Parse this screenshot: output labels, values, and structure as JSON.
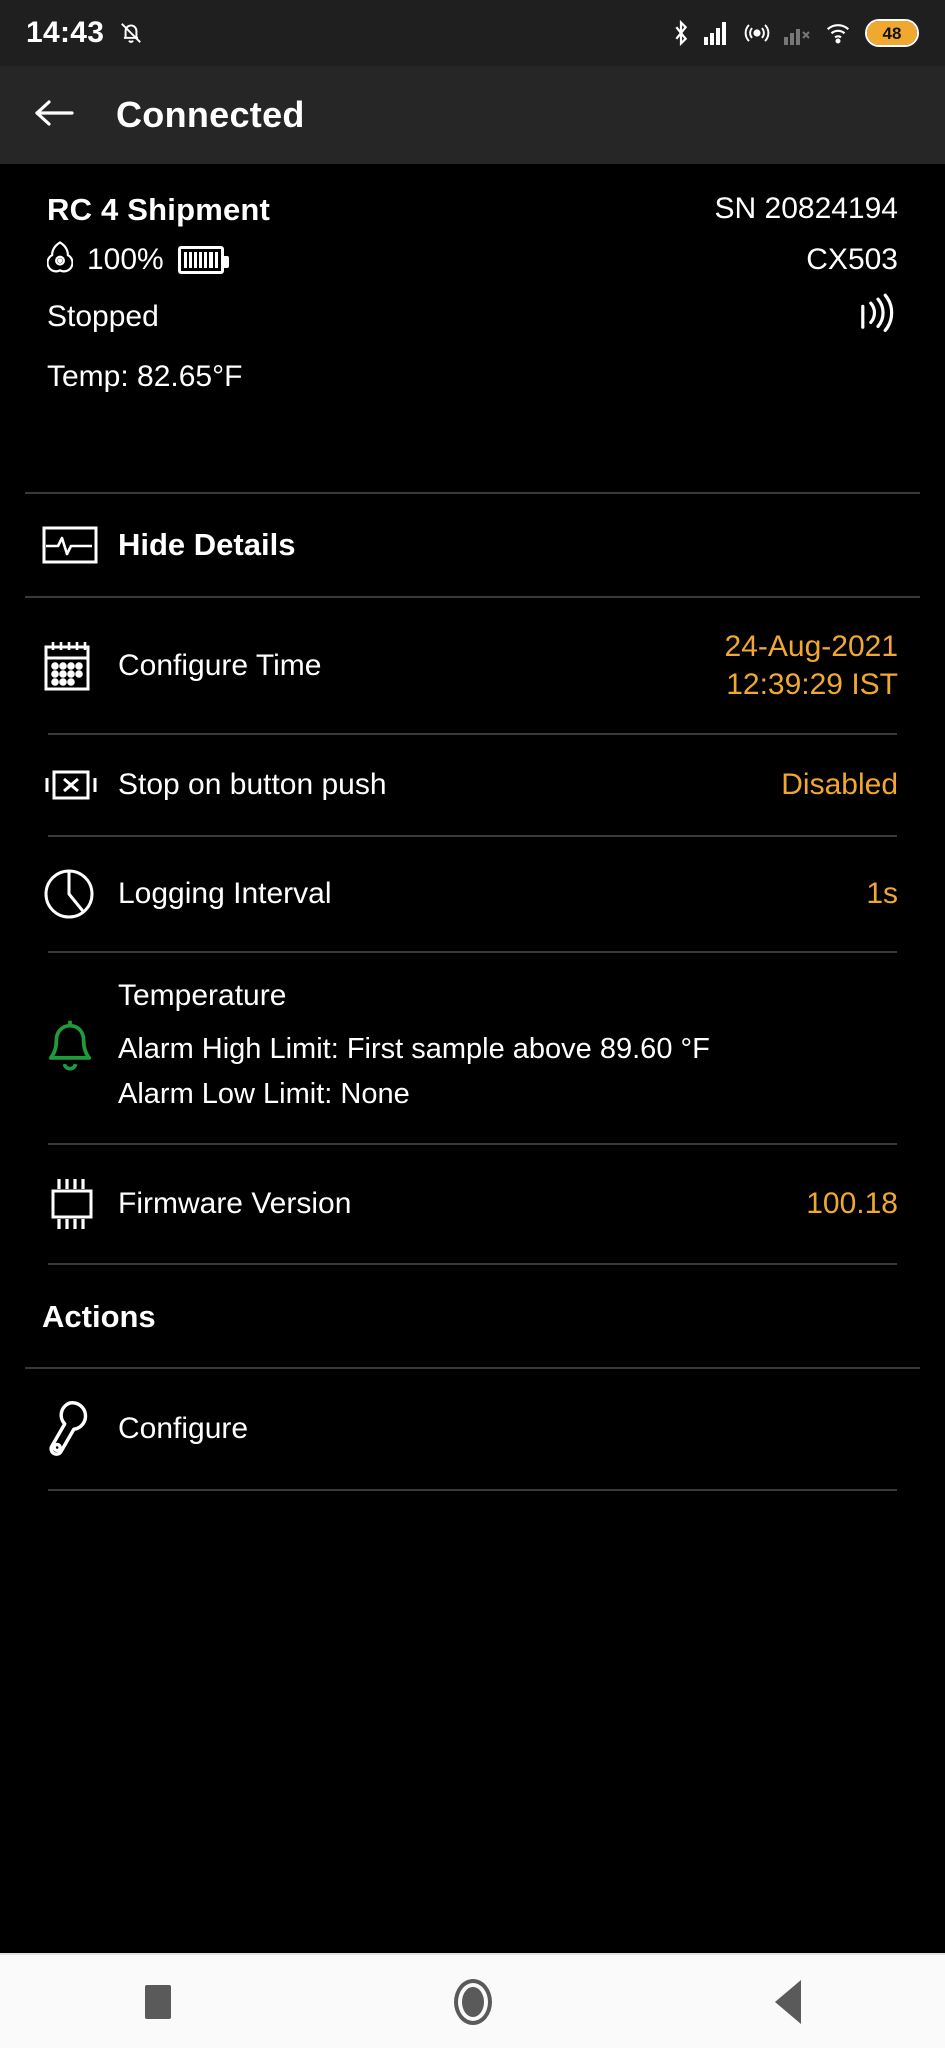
{
  "status_bar": {
    "time": "14:43",
    "icons": [
      "bell-muted-icon",
      "bluetooth-icon",
      "signal-bars-icon",
      "hotspot-icon",
      "signal-off-icon",
      "wifi-icon"
    ],
    "battery_percent": "48"
  },
  "app_bar": {
    "back_icon": "back-arrow-icon",
    "title": "Connected"
  },
  "device": {
    "name": "RC 4 Shipment",
    "serial": "SN 20824194",
    "memory_icon": "memory-icon",
    "battery_percent": "100%",
    "battery_icon": "battery-full-icon",
    "model": "CX503",
    "status": "Stopped",
    "temperature": "Temp: 82.65°F",
    "antenna_icon": "antenna-signal-icon"
  },
  "details": {
    "toggle": {
      "icon": "chart-monitor-icon",
      "label": "Hide Details"
    },
    "rows": [
      {
        "icon": "calendar-icon",
        "label": "Configure Time",
        "value": "24-Aug-2021\n12:39:29 IST"
      },
      {
        "icon": "button-stop-icon",
        "label": "Stop on button push",
        "value": "Disabled"
      },
      {
        "icon": "clock-icon",
        "label": "Logging Interval",
        "value": "1s"
      }
    ],
    "alarm": {
      "icon": "bell-icon",
      "icon_color": "#1f9c3a",
      "title": "Temperature",
      "high_limit": "Alarm High Limit:  First sample above 89.60 °F",
      "low_limit": "Alarm Low Limit:  None"
    },
    "firmware": {
      "icon": "chip-icon",
      "label": "Firmware Version",
      "value": "100.18"
    }
  },
  "actions": {
    "heading": "Actions",
    "items": [
      {
        "icon": "wrench-icon",
        "label": "Configure"
      }
    ]
  },
  "nav_bar": {
    "recents_icon": "square-recents-icon",
    "home_icon": "circle-home-icon",
    "back_icon": "triangle-back-icon"
  },
  "colors": {
    "accent": "#f0a830",
    "background": "#000000",
    "app_bar": "#262626",
    "status_bar": "#1f1f1f",
    "divider": "#3a3a3a",
    "alarm_green": "#1f9c3a"
  }
}
